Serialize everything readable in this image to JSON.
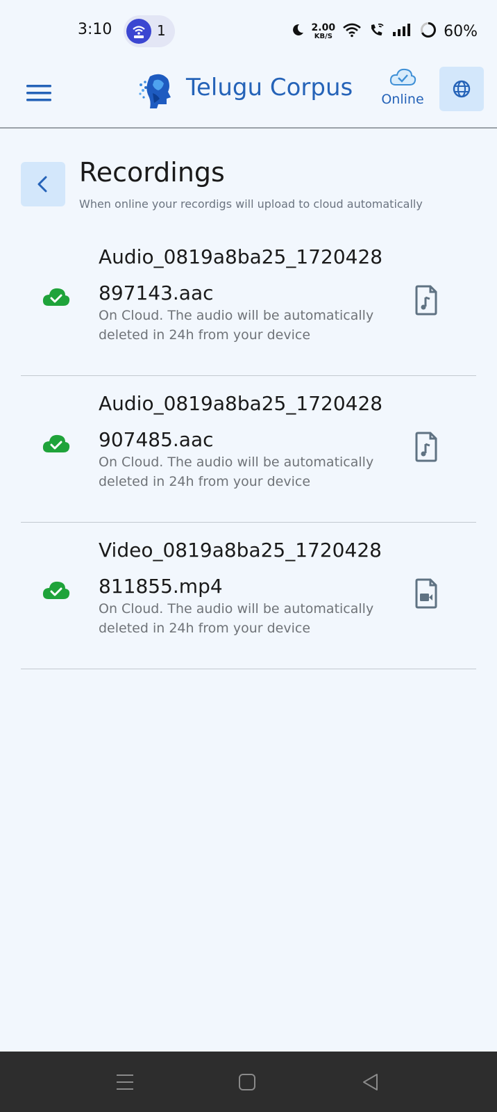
{
  "status_bar": {
    "time": "3:10",
    "notification_count": "1",
    "net_speed_value": "2.00",
    "net_speed_unit": "KB/S",
    "battery": "60%",
    "icons": [
      "moon-icon",
      "wifi-icon",
      "wifi-call-icon",
      "signal-icon",
      "battery-icon"
    ]
  },
  "app_bar": {
    "title": "Telugu Corpus",
    "connection_status": "Online"
  },
  "page": {
    "title": "Recordings",
    "subtitle": "When online your recordigs will upload to cloud automatically"
  },
  "recordings": [
    {
      "name": "Audio_0819a8ba25_1720428897143.aac",
      "status_text": "On Cloud. The audio will be automatically deleted in 24h from your device",
      "file_icon": "audio-file-icon",
      "sync_icon": "cloud-check-icon"
    },
    {
      "name": "Audio_0819a8ba25_1720428907485.aac",
      "status_text": "On Cloud. The audio will be automatically deleted in 24h from your device",
      "file_icon": "audio-file-icon",
      "sync_icon": "cloud-check-icon"
    },
    {
      "name": "Video_0819a8ba25_1720428811855.mp4",
      "status_text": "On Cloud. The audio will be automatically deleted in 24h from your device",
      "file_icon": "video-file-icon",
      "sync_icon": "cloud-check-icon"
    }
  ],
  "colors": {
    "accent": "#2563b8",
    "synced": "#1fa33a",
    "background": "#f2f7fd",
    "button_bg": "#d3e7fb"
  }
}
